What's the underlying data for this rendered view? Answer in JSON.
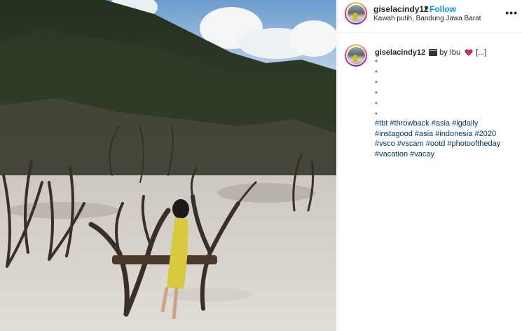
{
  "post": {
    "username": "giselacindy12",
    "separator": "•",
    "follow_label": "Follow",
    "location": "Kawah putih, Bandung Jawa Barat",
    "more_label": "•••"
  },
  "caption": {
    "username": "giselacindy12",
    "by_text": "by Ibu",
    "ellipsis": "[...]",
    "stars": [
      "*",
      "*",
      "*",
      "*",
      "*",
      "*"
    ],
    "hashtags": [
      "#tbt",
      "#throwback",
      "#asia",
      "#igdaily",
      "#instagood",
      "#asia",
      "#indonesia",
      "#2020",
      "#vsco",
      "#vscam",
      "#ootd",
      "#photooftheday",
      "#vacation",
      "#vacay"
    ]
  },
  "icons": {
    "clapper": "clapper-board-icon",
    "heart": "heart-icon",
    "more": "more-options-icon"
  },
  "colors": {
    "follow": "#0095f6",
    "hashtag": "#00376b",
    "heart": "#e0245e"
  }
}
